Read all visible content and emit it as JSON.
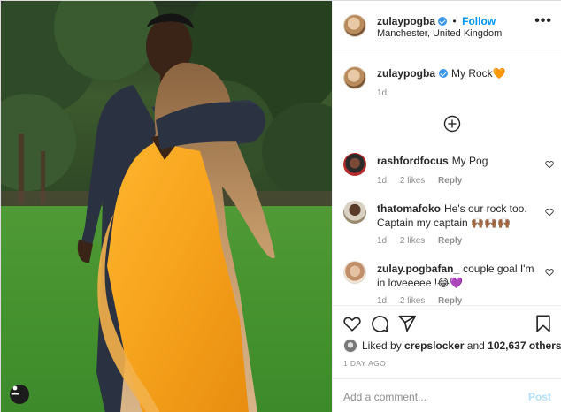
{
  "post": {
    "photo_alt": "",
    "user_tag_icon": "person-icon"
  },
  "header": {
    "username": "zulaypogba",
    "dot": "•",
    "follow_label": "Follow",
    "location": "Manchester, United Kingdom",
    "more_icon": "more-horizontal-icon",
    "more_label": "•••"
  },
  "caption": {
    "username": "zulaypogba",
    "text": "My Rock🧡",
    "time": "1d"
  },
  "load_more_icon": "plus-circle-icon",
  "comments": [
    {
      "username": "rashfordfocus",
      "text": "My Pog",
      "time": "1d",
      "likes": "2 likes",
      "reply": "Reply"
    },
    {
      "username": "thatomafoko",
      "text": "He's our rock too. Captain my captain 🙌🏾🙌🏾🙌🏾",
      "time": "1d",
      "likes": "2 likes",
      "reply": "Reply"
    },
    {
      "username": "zulay.pogbafan_",
      "text": "couple goal I'm in loveeeee !😂💜",
      "time": "1d",
      "likes": "2 likes",
      "reply": "Reply"
    }
  ],
  "actions": {
    "icons": [
      "heart-icon",
      "comment-icon",
      "share-icon",
      "bookmark-icon"
    ],
    "liked_prefix": "Liked by ",
    "liked_user": "crepslocker",
    "liked_and": " and ",
    "liked_count": "102,637 others",
    "date": "1 DAY AGO"
  },
  "add_comment": {
    "placeholder": "Add a comment...",
    "post_label": "Post"
  },
  "colors": {
    "link_blue": "#0095f6",
    "verified_blue": "#3897f0",
    "muted": "#8e8e8e",
    "post_disabled": "#b2dffc"
  }
}
